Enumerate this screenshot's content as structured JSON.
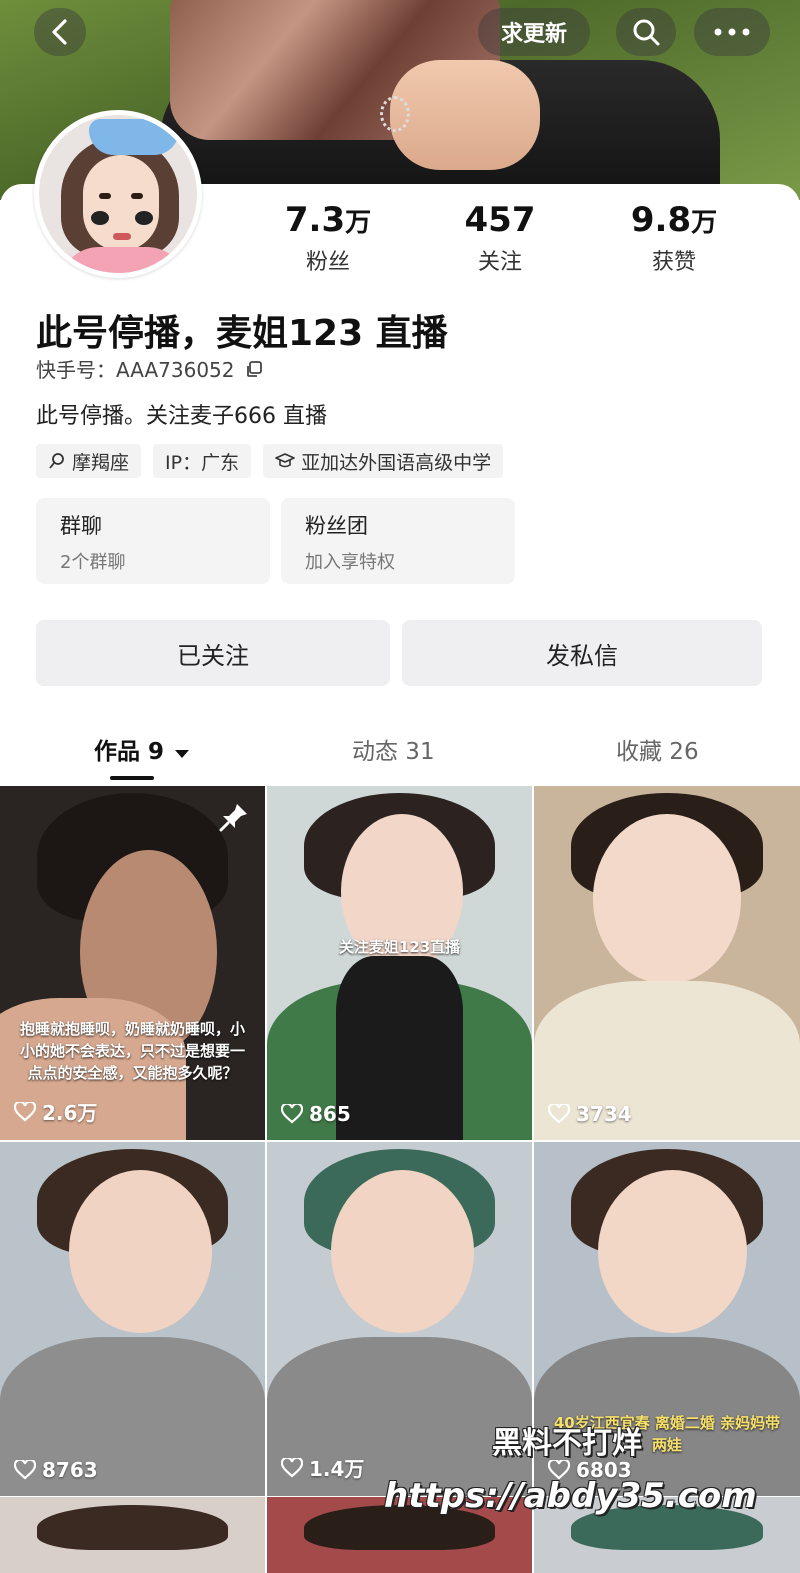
{
  "header": {
    "update_label": "求更新"
  },
  "stats": [
    {
      "value": "7.3",
      "unit": "万",
      "label": "粉丝"
    },
    {
      "value": "457",
      "unit": "",
      "label": "关注"
    },
    {
      "value": "9.8",
      "unit": "万",
      "label": "获赞"
    }
  ],
  "profile": {
    "name": "此号停播，麦姐123 直播",
    "uid": "快手号：AAA736052",
    "bio": "此号停播。关注麦子666 直播",
    "tags": [
      "摩羯座",
      "IP：广东",
      "亚加达外国语高级中学"
    ]
  },
  "groups": [
    {
      "title": "群聊",
      "subtitle": "2个群聊"
    },
    {
      "title": "粉丝团",
      "subtitle": "加入享特权"
    }
  ],
  "actions": {
    "follow_label": "已关注",
    "message_label": "发私信"
  },
  "tabs": [
    {
      "label": "作品 9"
    },
    {
      "label": "动态 31"
    },
    {
      "label": "收藏 26"
    }
  ],
  "videos": [
    {
      "likes": "2.6万",
      "caption": "抱睡就抱睡呗，奶睡就奶睡呗，小小的她不会表达，只不过是想要一点点的安全感，又能抱多久呢？"
    },
    {
      "likes": "865",
      "caption": "关注麦姐123直播"
    },
    {
      "likes": "3734",
      "caption": ""
    },
    {
      "likes": "8763",
      "caption": ""
    },
    {
      "likes": "1.4万",
      "caption": ""
    },
    {
      "likes": "6803",
      "caption": "40岁江西宜春 离婚二婚 亲妈妈带两娃"
    }
  ],
  "watermark": {
    "line1": "黑料不打烊",
    "line2": "https://abdy35.com"
  },
  "colors": {
    "background": "#ffffff",
    "chip_background": "#f3f3f4",
    "button_background": "#efeff1",
    "text_primary": "#111111",
    "text_secondary": "#777777"
  },
  "icons": [
    "back-arrow-icon",
    "search-icon",
    "more-icon",
    "copy-icon",
    "zodiac-icon",
    "school-icon",
    "caret-down-icon",
    "pin-icon",
    "heart-icon"
  ]
}
